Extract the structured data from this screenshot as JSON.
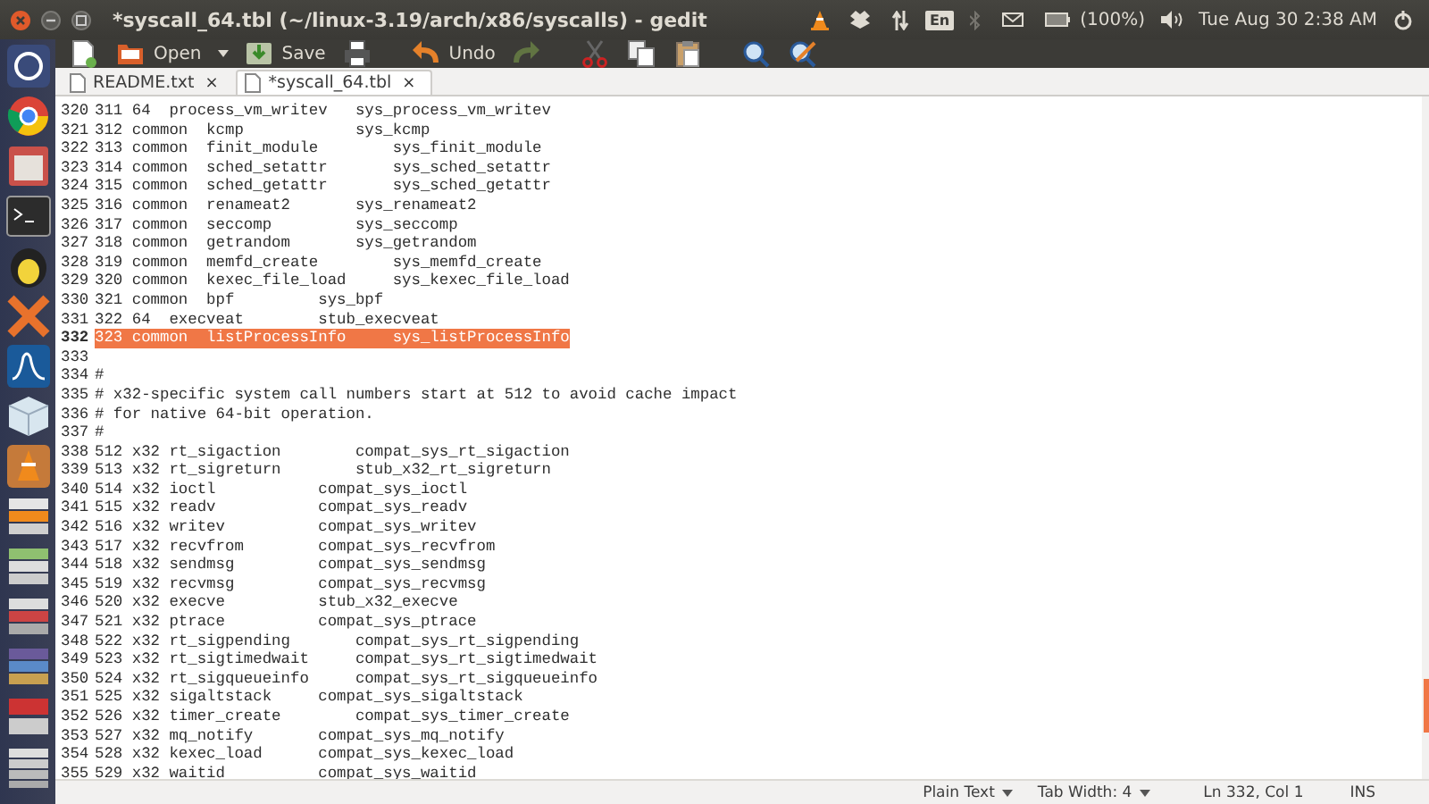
{
  "window": {
    "title": "*syscall_64.tbl (~/linux-3.19/arch/x86/syscalls) - gedit"
  },
  "panel": {
    "keyboard": "En",
    "battery": "(100%)",
    "clock": "Tue Aug 30  2:38 AM"
  },
  "toolbar": [
    {
      "kind": "new"
    },
    {
      "kind": "open",
      "label": "Open"
    },
    {
      "kind": "save",
      "label": "Save"
    },
    {
      "kind": "print"
    },
    {
      "kind": "undo",
      "label": "Undo"
    },
    {
      "kind": "redo",
      "disabled": true
    },
    {
      "kind": "cut"
    },
    {
      "kind": "copy"
    },
    {
      "kind": "paste"
    },
    {
      "kind": "search"
    },
    {
      "kind": "replace"
    }
  ],
  "tabs": [
    {
      "label": "README.txt",
      "close": "×",
      "selected": false
    },
    {
      "label": "*syscall_64.tbl",
      "close": "×",
      "selected": true
    }
  ],
  "lines": [
    {
      "number": "320",
      "text": "311 64  process_vm_writev   sys_process_vm_writev",
      "highlighted": false
    },
    {
      "number": "321",
      "text": "312 common  kcmp            sys_kcmp",
      "highlighted": false
    },
    {
      "number": "322",
      "text": "313 common  finit_module        sys_finit_module",
      "highlighted": false
    },
    {
      "number": "323",
      "text": "314 common  sched_setattr       sys_sched_setattr",
      "highlighted": false
    },
    {
      "number": "324",
      "text": "315 common  sched_getattr       sys_sched_getattr",
      "highlighted": false
    },
    {
      "number": "325",
      "text": "316 common  renameat2       sys_renameat2",
      "highlighted": false
    },
    {
      "number": "326",
      "text": "317 common  seccomp         sys_seccomp",
      "highlighted": false
    },
    {
      "number": "327",
      "text": "318 common  getrandom       sys_getrandom",
      "highlighted": false
    },
    {
      "number": "328",
      "text": "319 common  memfd_create        sys_memfd_create",
      "highlighted": false
    },
    {
      "number": "329",
      "text": "320 common  kexec_file_load     sys_kexec_file_load",
      "highlighted": false
    },
    {
      "number": "330",
      "text": "321 common  bpf         sys_bpf",
      "highlighted": false
    },
    {
      "number": "331",
      "text": "322 64  execveat        stub_execveat",
      "highlighted": false
    },
    {
      "number": "332",
      "text": "323 common  listProcessInfo     sys_listProcessInfo",
      "highlighted": true
    },
    {
      "number": "333",
      "highlighted": false
    },
    {
      "number": "334",
      "text": "#",
      "highlighted": false
    },
    {
      "number": "335",
      "text": "# x32-specific system call numbers start at 512 to avoid cache impact",
      "highlighted": false
    },
    {
      "number": "336",
      "text": "# for native 64-bit operation.",
      "highlighted": false
    },
    {
      "number": "337",
      "text": "#",
      "highlighted": false
    },
    {
      "number": "338",
      "text": "512 x32 rt_sigaction        compat_sys_rt_sigaction",
      "highlighted": false
    },
    {
      "number": "339",
      "text": "513 x32 rt_sigreturn        stub_x32_rt_sigreturn",
      "highlighted": false
    },
    {
      "number": "340",
      "text": "514 x32 ioctl           compat_sys_ioctl",
      "highlighted": false
    },
    {
      "number": "341",
      "text": "515 x32 readv           compat_sys_readv",
      "highlighted": false
    },
    {
      "number": "342",
      "text": "516 x32 writev          compat_sys_writev",
      "highlighted": false
    },
    {
      "number": "343",
      "text": "517 x32 recvfrom        compat_sys_recvfrom",
      "highlighted": false
    },
    {
      "number": "344",
      "text": "518 x32 sendmsg         compat_sys_sendmsg",
      "highlighted": false
    },
    {
      "number": "345",
      "text": "519 x32 recvmsg         compat_sys_recvmsg",
      "highlighted": false
    },
    {
      "number": "346",
      "text": "520 x32 execve          stub_x32_execve",
      "highlighted": false
    },
    {
      "number": "347",
      "text": "521 x32 ptrace          compat_sys_ptrace",
      "highlighted": false
    },
    {
      "number": "348",
      "text": "522 x32 rt_sigpending       compat_sys_rt_sigpending",
      "highlighted": false
    },
    {
      "number": "349",
      "text": "523 x32 rt_sigtimedwait     compat_sys_rt_sigtimedwait",
      "highlighted": false
    },
    {
      "number": "350",
      "text": "524 x32 rt_sigqueueinfo     compat_sys_rt_sigqueueinfo",
      "highlighted": false
    },
    {
      "number": "351",
      "text": "525 x32 sigaltstack     compat_sys_sigaltstack",
      "highlighted": false
    },
    {
      "number": "352",
      "text": "526 x32 timer_create        compat_sys_timer_create",
      "highlighted": false
    },
    {
      "number": "353",
      "text": "527 x32 mq_notify       compat_sys_mq_notify",
      "highlighted": false
    },
    {
      "number": "354",
      "text": "528 x32 kexec_load      compat_sys_kexec_load",
      "highlighted": false
    },
    {
      "number": "355",
      "text": "529 x32 waitid          compat_sys_waitid",
      "highlighted": false
    }
  ],
  "status_bar": {
    "language": "Plain Text",
    "tab_width": "Tab Width: 4",
    "position": "Ln 332, Col 1",
    "mode": "INS"
  }
}
